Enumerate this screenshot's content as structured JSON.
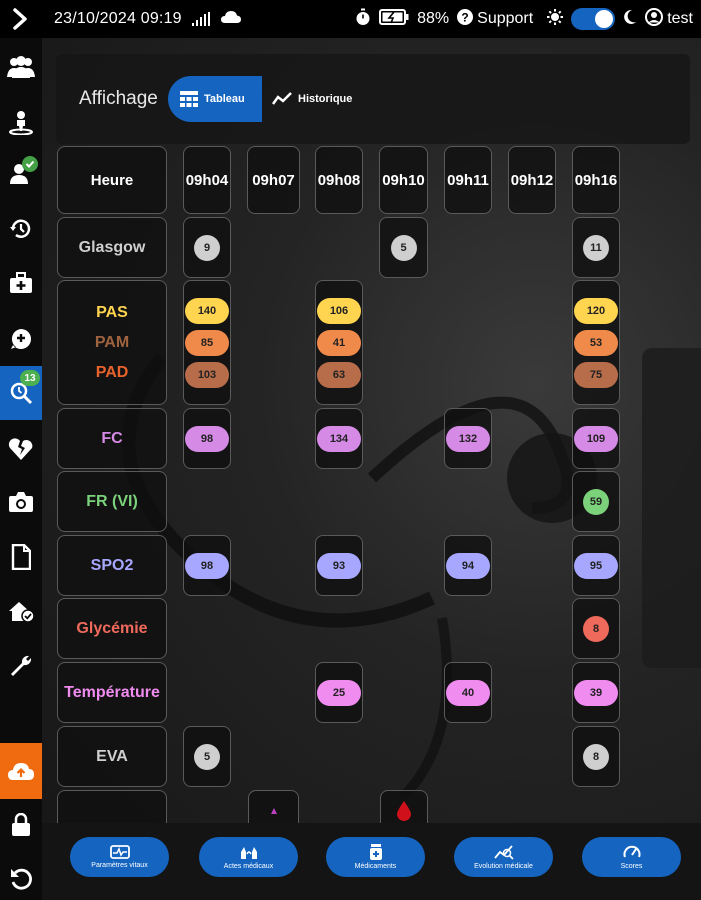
{
  "status_bar": {
    "datetime": "23/10/2024 09:19",
    "battery": "88%",
    "support_label": "Support",
    "user": "test",
    "dark_mode_on": true
  },
  "sidebar": {
    "items": [
      {
        "icon": "group-icon"
      },
      {
        "icon": "person-pin-icon"
      },
      {
        "icon": "person-check-icon"
      },
      {
        "icon": "history-icon"
      },
      {
        "icon": "medical-kit-icon"
      },
      {
        "icon": "chat-icon"
      },
      {
        "icon": "search-clock-icon",
        "badge": "13",
        "active": true
      },
      {
        "icon": "broken-heart-icon"
      },
      {
        "icon": "camera-icon"
      },
      {
        "icon": "document-icon"
      },
      {
        "icon": "home-check-icon"
      },
      {
        "icon": "wrench-icon"
      },
      {
        "icon": "cloud-upload-icon"
      },
      {
        "icon": "lock-icon"
      },
      {
        "icon": "undo-icon"
      }
    ],
    "colors": {
      "active": "#1565c0",
      "upload": "#f06a0f",
      "badge": "#4caf50"
    }
  },
  "affichage": {
    "label": "Affichage",
    "tabs": [
      {
        "label": "Tableau",
        "active": true
      },
      {
        "label": "Historique",
        "active": false
      }
    ]
  },
  "table": {
    "header_label": "Heure",
    "times": [
      "09h04",
      "09h07",
      "09h08",
      "09h10",
      "09h11",
      "09h12",
      "09h16"
    ],
    "rows": [
      {
        "key": "glasgow",
        "label": "Glasgow",
        "color": "#cfcfcf",
        "values": {
          "09h04": "9",
          "09h10": "5",
          "09h16": "11"
        }
      },
      {
        "key": "pas",
        "label": "PAS",
        "color": "#ffd54f",
        "values": {
          "09h04": "140",
          "09h08": "106",
          "09h16": "120"
        }
      },
      {
        "key": "pam",
        "label": "PAM",
        "color": "#a0633f",
        "values": {
          "09h04": "85",
          "09h08": "41",
          "09h16": "53"
        }
      },
      {
        "key": "pad",
        "label": "PAD",
        "color": "#e8622c",
        "values": {
          "09h04": "103",
          "09h08": "63",
          "09h16": "75"
        }
      },
      {
        "key": "fc",
        "label": "FC",
        "color": "#d58ae6",
        "values": {
          "09h04": "98",
          "09h08": "134",
          "09h11": "132",
          "09h16": "109"
        }
      },
      {
        "key": "fr",
        "label": "FR (VI)",
        "color": "#7bd27b",
        "values": {
          "09h16": "59"
        }
      },
      {
        "key": "spo2",
        "label": "SPO2",
        "color": "#a7a7ff",
        "values": {
          "09h04": "98",
          "09h08": "93",
          "09h11": "94",
          "09h16": "95"
        }
      },
      {
        "key": "glycemie",
        "label": "Glycémie",
        "color": "#f06a5c",
        "values": {
          "09h16": "8"
        }
      },
      {
        "key": "temperature",
        "label": "Température",
        "color": "#f08cf0",
        "values": {
          "09h08": "25",
          "09h11": "40",
          "09h16": "39"
        }
      },
      {
        "key": "eva",
        "label": "EVA",
        "color": "#cfcfcf",
        "values": {
          "09h04": "5",
          "09h16": "8"
        }
      }
    ]
  },
  "bottom_actions": [
    {
      "label": "Paramètres vitaux",
      "icon": "vitals-icon"
    },
    {
      "label": "Actes médicaux",
      "icon": "hands-icon"
    },
    {
      "label": "Médicaments",
      "icon": "medicine-icon"
    },
    {
      "label": "Evolution médicale",
      "icon": "evolution-icon"
    },
    {
      "label": "Scores",
      "icon": "gauge-icon"
    }
  ]
}
